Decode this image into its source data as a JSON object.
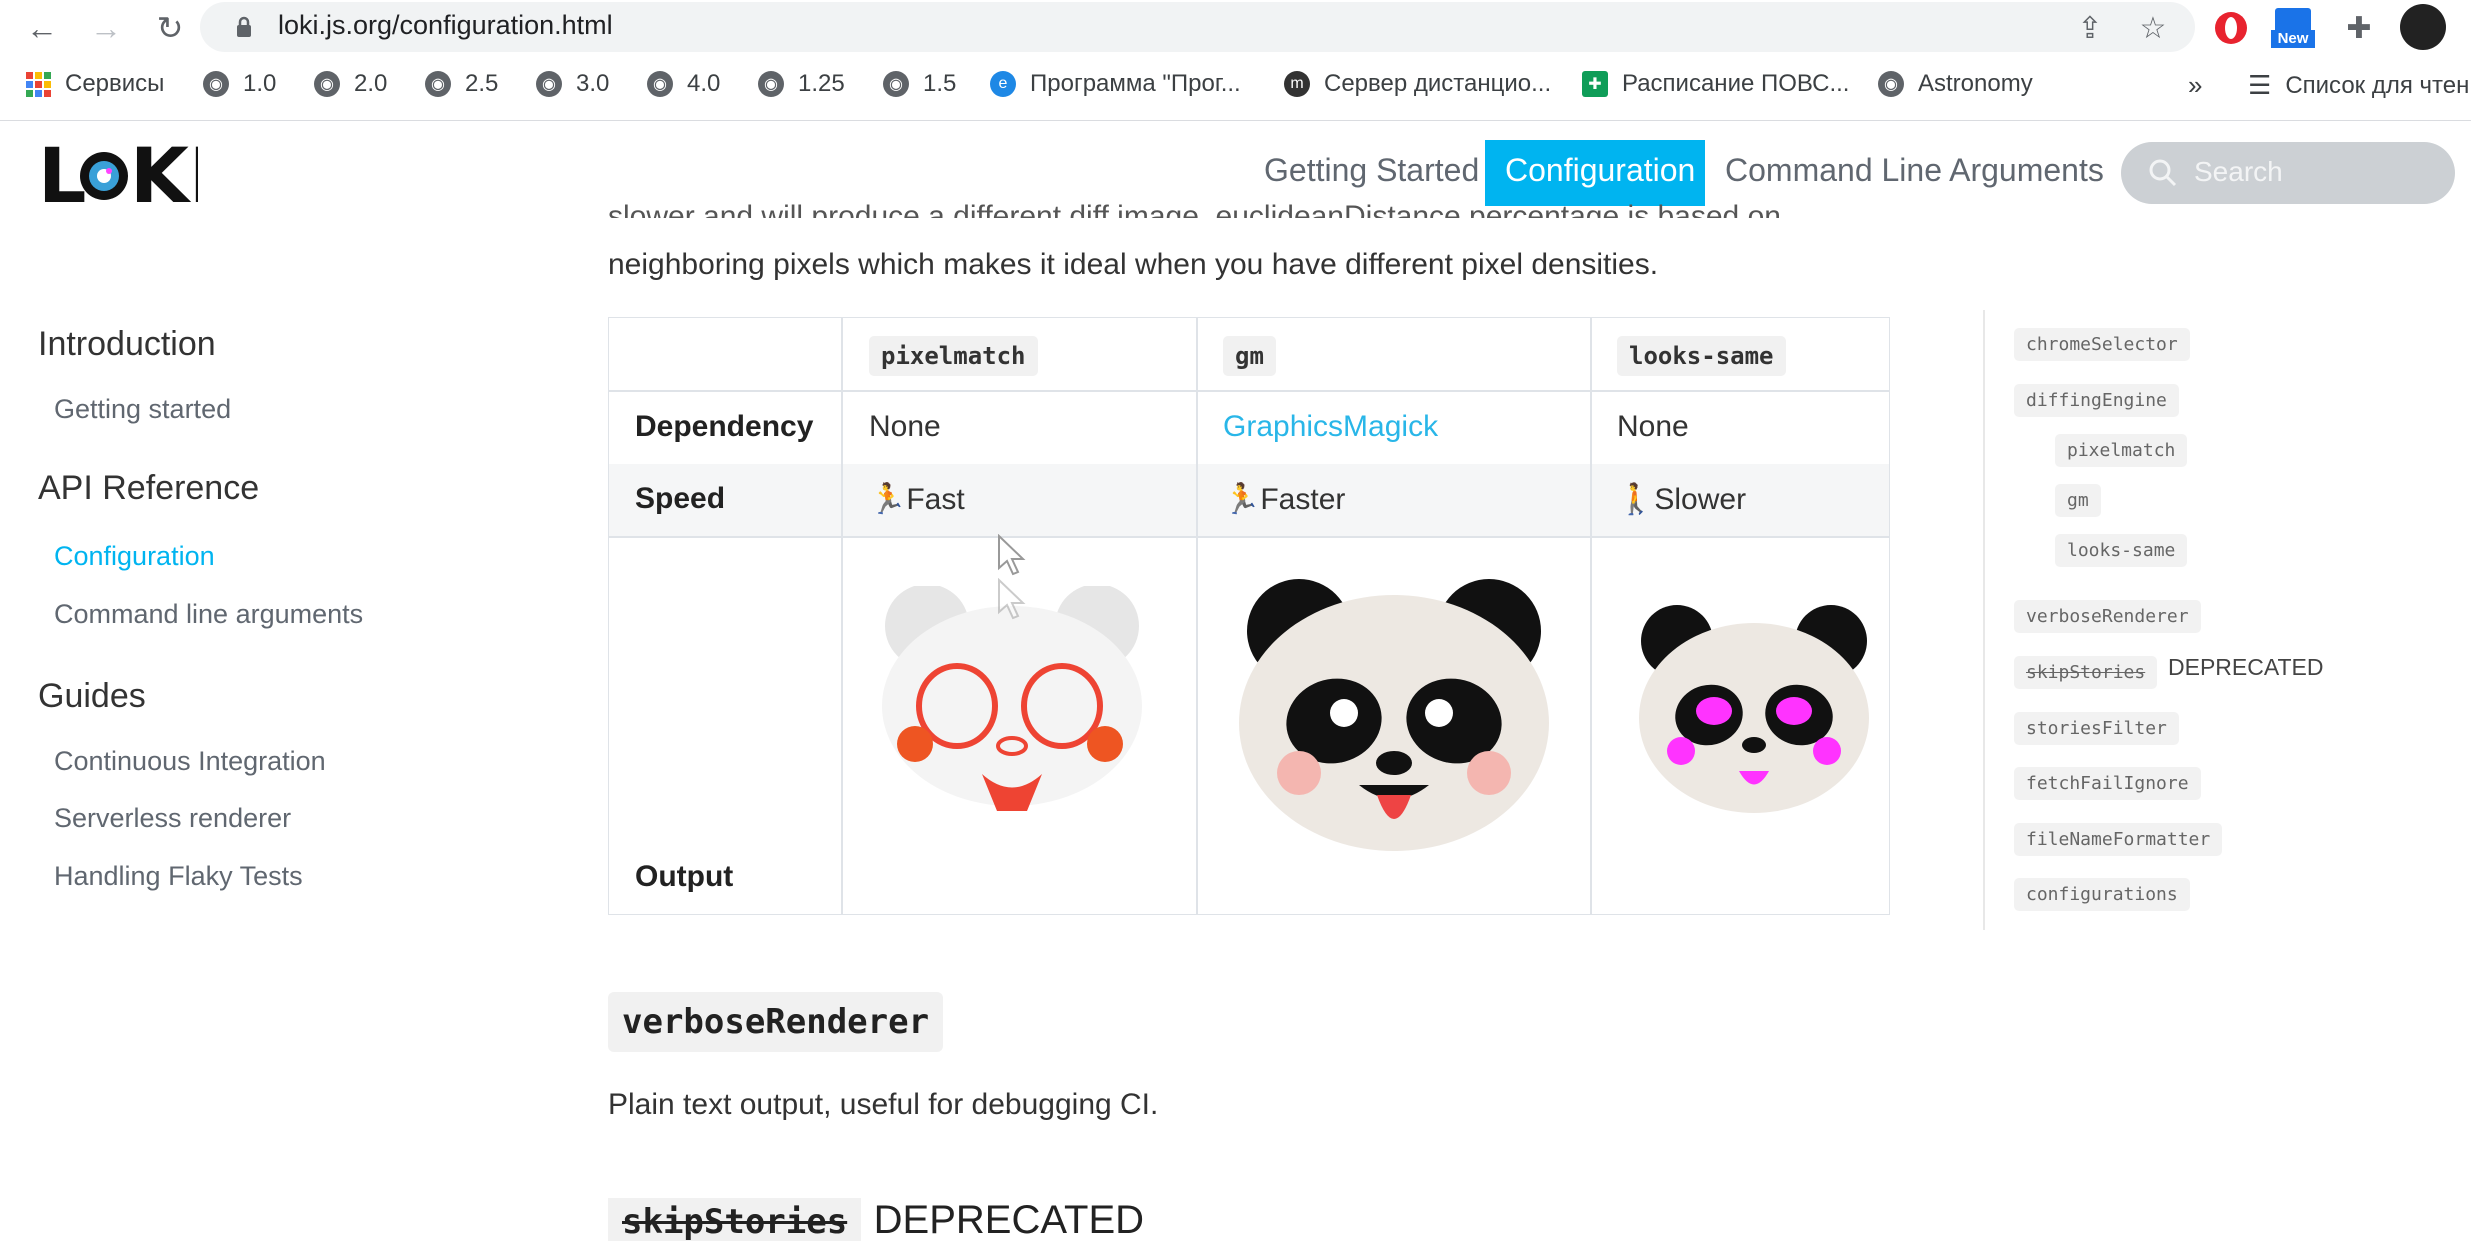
{
  "browser": {
    "url": "loki.js.org/configuration.html",
    "badge_new": "New",
    "bookmarks": [
      {
        "label": "Сервисы",
        "icon": "apps-grid-icon"
      },
      {
        "label": "1.0",
        "icon": "globe-icon"
      },
      {
        "label": "2.0",
        "icon": "globe-icon"
      },
      {
        "label": "2.5",
        "icon": "globe-icon"
      },
      {
        "label": "3.0",
        "icon": "globe-icon"
      },
      {
        "label": "4.0",
        "icon": "globe-icon"
      },
      {
        "label": "1.25",
        "icon": "globe-icon"
      },
      {
        "label": "1.5",
        "icon": "globe-icon"
      },
      {
        "label": "Программа \"Прог...",
        "icon": "edge-icon"
      },
      {
        "label": "Сервер дистанцио...",
        "icon": "moodle-icon"
      },
      {
        "label": "Расписание ПОВС...",
        "icon": "sheets-icon"
      },
      {
        "label": "Astronomy",
        "icon": "globe-icon"
      }
    ],
    "overflow": "»",
    "reading_list": "Список для чтен"
  },
  "header": {
    "logo": "LOKI",
    "nav": [
      "Getting Started",
      "Configuration",
      "Command Line Arguments"
    ],
    "active_nav": "Configuration",
    "search_placeholder": "Search"
  },
  "sidebar": {
    "sections": [
      {
        "title": "Introduction",
        "items": [
          "Getting started"
        ]
      },
      {
        "title": "API Reference",
        "items": [
          "Configuration",
          "Command line arguments"
        ]
      },
      {
        "title": "Guides",
        "items": [
          "Continuous Integration",
          "Serverless renderer",
          "Handling Flaky Tests"
        ]
      }
    ],
    "active_item": "Configuration"
  },
  "main": {
    "partial_line_top": "slower and will produce a different diff image. euclideanDistance percentage is based on",
    "paragraph": "neighboring pixels which makes it ideal when you have different pixel densities.",
    "table": {
      "columns": [
        "pixelmatch",
        "gm",
        "looks-same"
      ],
      "rows": [
        {
          "label": "Dependency",
          "cells": [
            "None",
            "GraphicsMagick",
            "None"
          ]
        },
        {
          "label": "Speed",
          "cells": [
            "Fast",
            "Faster",
            "Slower"
          ]
        },
        {
          "label": "Output",
          "cells": [
            "",
            "",
            ""
          ]
        }
      ]
    },
    "verbose_heading": "verboseRenderer",
    "verbose_text": "Plain text output, useful for debugging CI.",
    "skip_heading": "skipStories",
    "skip_deprecated": "DEPRECATED"
  },
  "toc": {
    "items": [
      "chromeSelector",
      "diffingEngine",
      "pixelmatch",
      "gm",
      "looks-same",
      "verboseRenderer",
      "skipStories",
      "storiesFilter",
      "fetchFailIgnore",
      "fileNameFormatter",
      "configurations"
    ],
    "deprecated_label": "DEPRECATED"
  },
  "colors": {
    "accent": "#25c2a0",
    "link": "#29b6e8"
  }
}
